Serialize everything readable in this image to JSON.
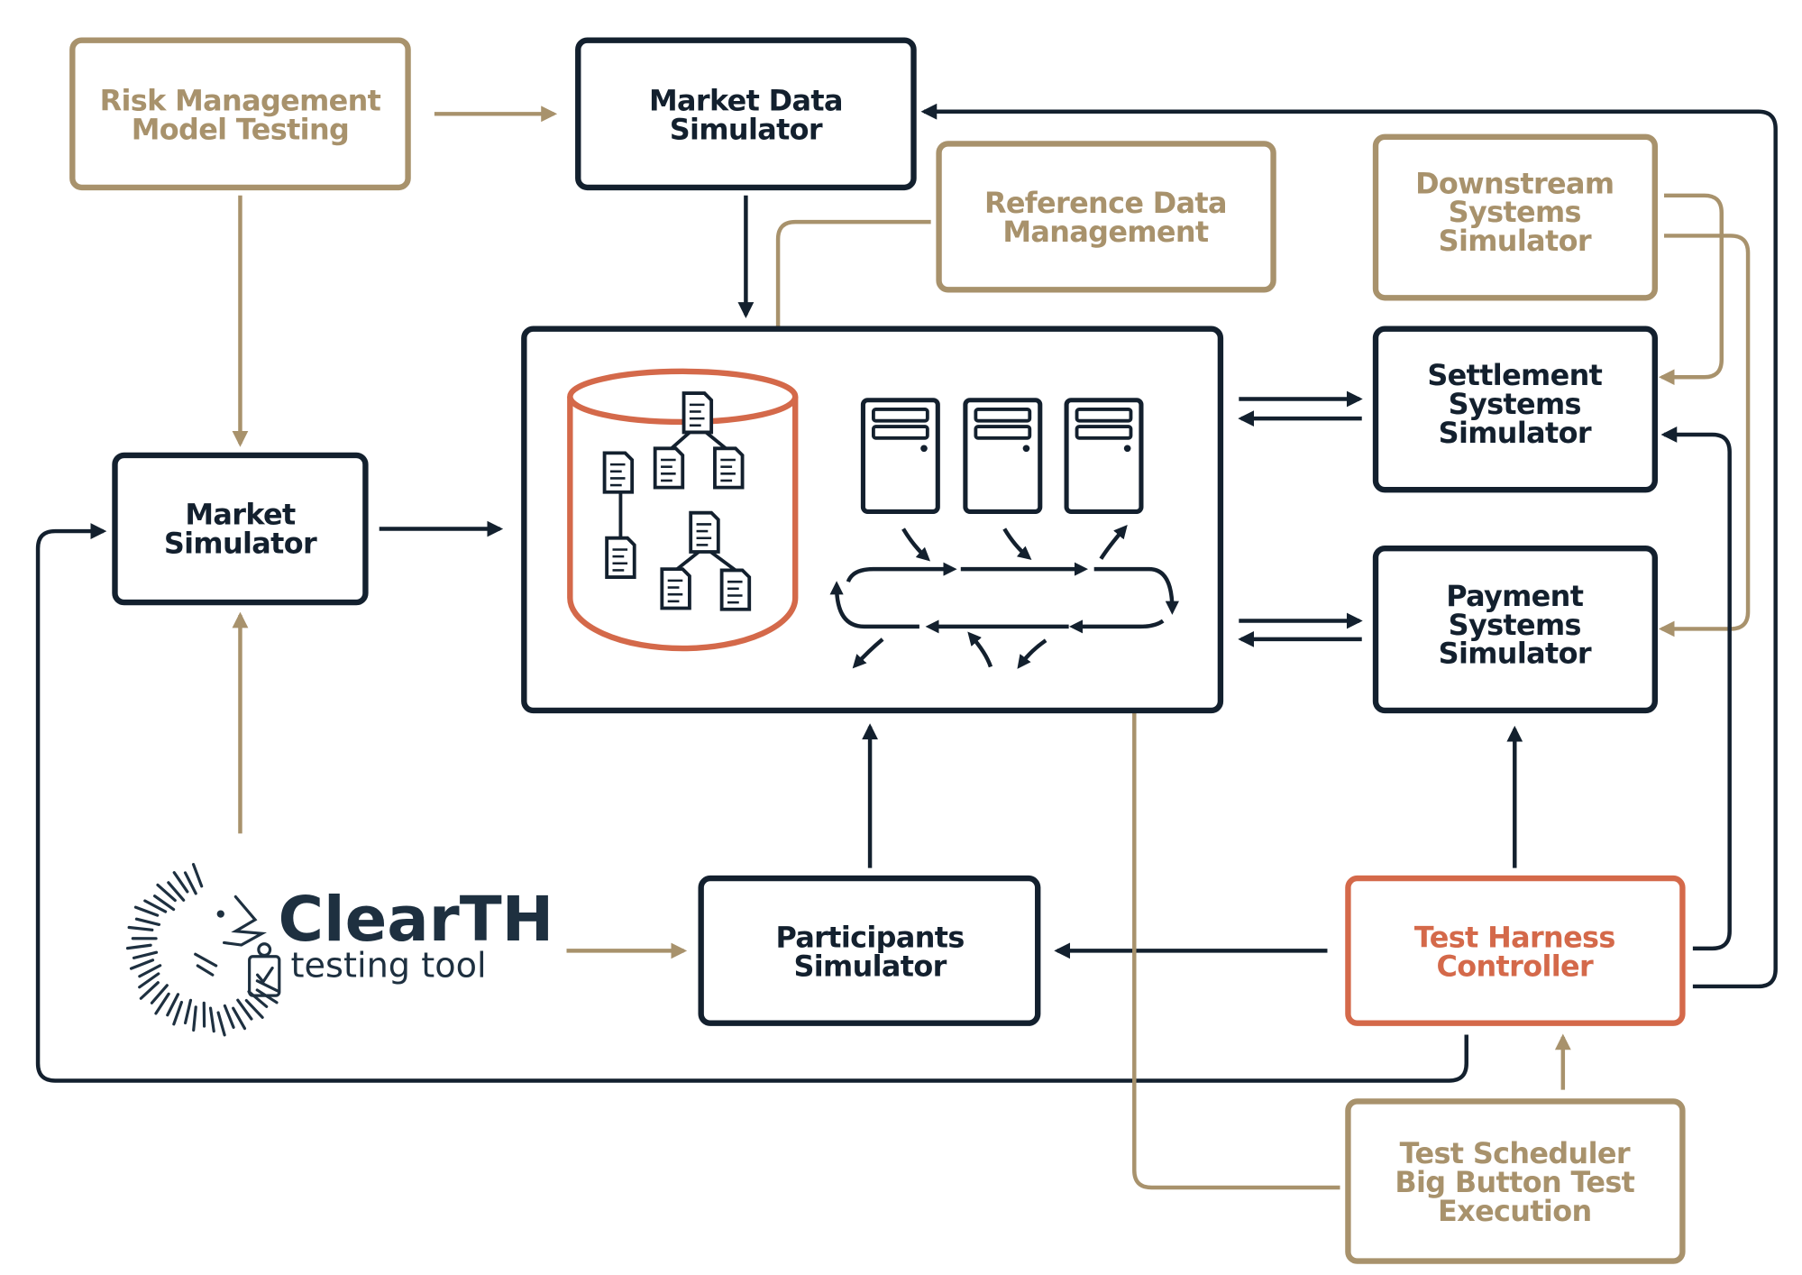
{
  "colors": {
    "dark": "#13202E",
    "tan": "#A8926C",
    "orange": "#D4694A"
  },
  "nodes": {
    "risk": {
      "lines": [
        "Risk Management",
        "Model Testing"
      ]
    },
    "market_data_sim": {
      "lines": [
        "Market Data",
        "Simulator"
      ]
    },
    "reference_data": {
      "lines": [
        "Reference Data",
        "Management"
      ]
    },
    "downstream": {
      "lines": [
        "Downstream",
        "Systems",
        "Simulator"
      ]
    },
    "settlement": {
      "lines": [
        "Settlement",
        "Systems",
        "Simulator"
      ]
    },
    "payment": {
      "lines": [
        "Payment",
        "Systems",
        "Simulator"
      ]
    },
    "market_sim": {
      "lines": [
        "Market",
        "Simulator"
      ]
    },
    "participants": {
      "lines": [
        "Participants",
        "Simulator"
      ]
    },
    "test_harness": {
      "lines": [
        "Test Harness",
        "Controller"
      ]
    },
    "scheduler": {
      "lines": [
        "Test Scheduler",
        "Big Button Test",
        "Execution"
      ]
    }
  },
  "logo": {
    "name": "ClearTH",
    "tagline": "testing tool",
    "icon": "hedgehog-with-lantern-icon"
  },
  "core_icons": [
    "database-cylinder-icon",
    "document-tree-icon",
    "server-icon",
    "cycle-arrows-icon"
  ]
}
